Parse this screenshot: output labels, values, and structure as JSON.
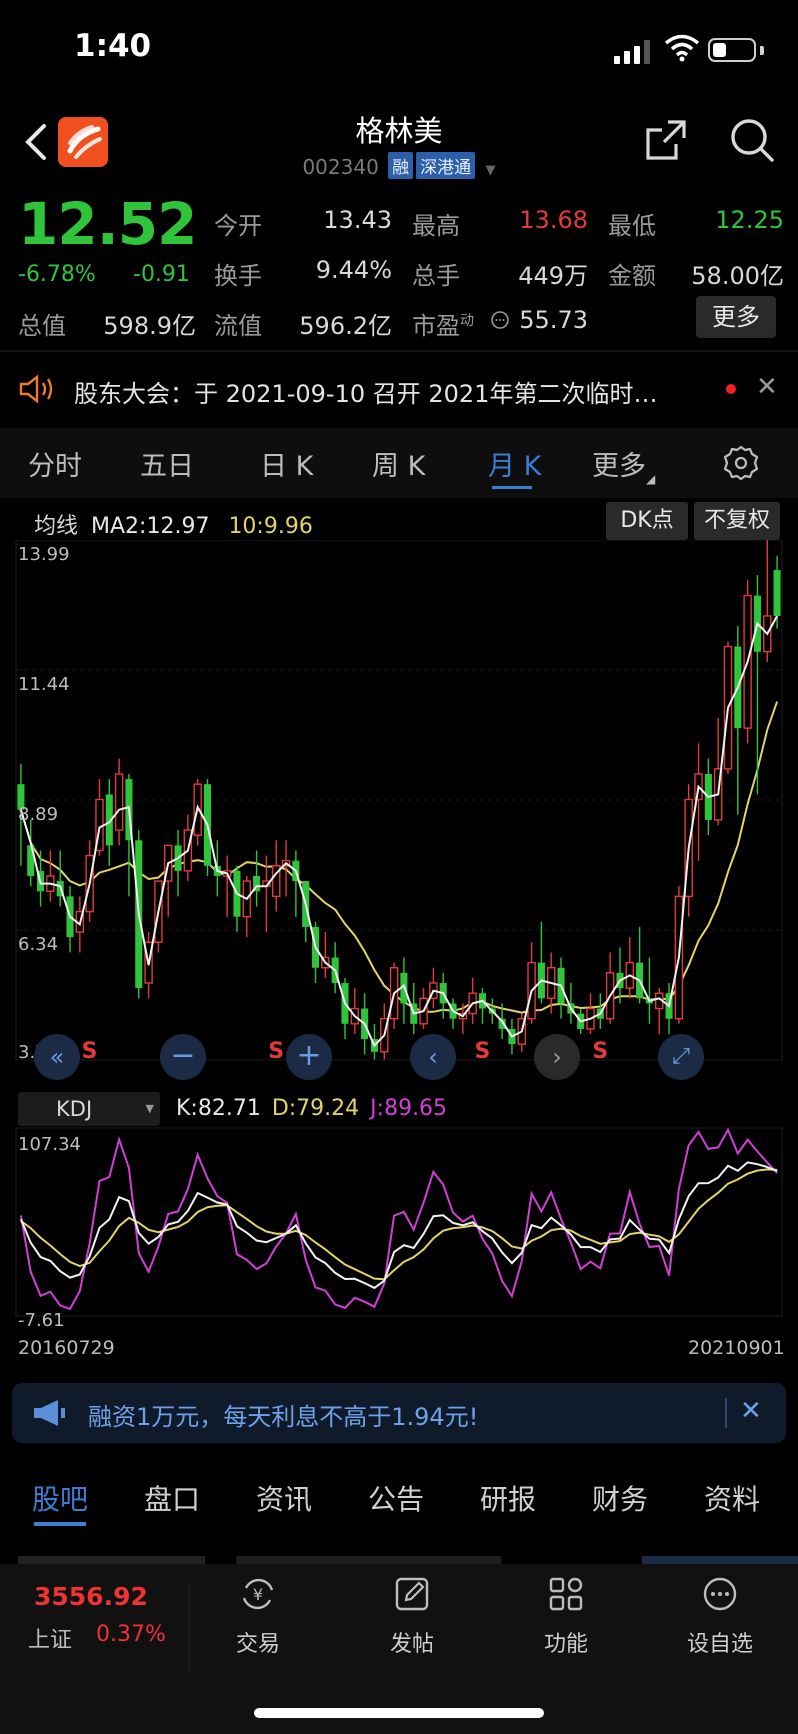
{
  "status_bar": {
    "time": "1:40"
  },
  "header": {
    "stock_name": "格林美",
    "stock_code": "002340",
    "tag_margin": "融",
    "tag_connect": "深港通",
    "icons": [
      "back-icon",
      "app-logo",
      "share-icon",
      "search-icon"
    ]
  },
  "quote": {
    "price": "12.52",
    "change_pct": "-6.78%",
    "change_amt": "-0.91",
    "open_label": "今开",
    "open": "13.43",
    "high_label": "最高",
    "high": "13.68",
    "low_label": "最低",
    "low": "12.25",
    "turnover_label": "换手",
    "turnover": "9.44%",
    "volume_label": "总手",
    "volume": "449万",
    "amount_label": "金额",
    "amount": "58.00亿",
    "mktcap_label": "总值",
    "mktcap": "598.9亿",
    "float_label": "流值",
    "float": "596.2亿",
    "pe_label": "市盈",
    "pe_sup": "动",
    "pe": "55.73",
    "more_label": "更多"
  },
  "colors": {
    "up": "#e33b3b",
    "down": "#2fc43a",
    "accent": "#3b7fd4",
    "ma_yellow": "#e3d46a",
    "kdj_j": "#d23fd6"
  },
  "notice": {
    "text": "股东大会：于 2021-09-10 召开 2021年第二次临时…"
  },
  "chart_tabs": [
    "分时",
    "五日",
    "日 K",
    "周 K",
    "月 K",
    "更多"
  ],
  "chart_tab_active": "月 K",
  "chart": {
    "ma_label": "均线",
    "ma2_text": "MA2:12.97",
    "ma10_text": "10:9.96",
    "dk_button": "DK点",
    "adjust_button": "不复权",
    "y_ticks": [
      "13.99",
      "11.44",
      "8.89",
      "6.34",
      "3.79"
    ],
    "signal_marker": "S"
  },
  "chart_data": [
    {
      "type": "candlestick",
      "title": "月 K",
      "ylim": [
        3.79,
        13.99
      ],
      "y_ticks": [
        13.99,
        11.44,
        8.89,
        6.34,
        3.79
      ],
      "x_range": [
        "20160729",
        "20210901"
      ],
      "candles": [
        [
          9.2,
          8.7,
          9.6,
          7.6
        ],
        [
          8.0,
          7.4,
          8.5,
          7.2
        ],
        [
          7.5,
          7.1,
          7.9,
          6.8
        ],
        [
          7.1,
          7.4,
          7.9,
          6.9
        ],
        [
          7.3,
          7.0,
          7.9,
          6.8
        ],
        [
          7.0,
          6.2,
          7.2,
          5.9
        ],
        [
          6.3,
          6.7,
          7.0,
          5.9
        ],
        [
          6.7,
          7.8,
          8.1,
          6.5
        ],
        [
          7.9,
          8.9,
          9.3,
          7.8
        ],
        [
          9.0,
          8.0,
          9.3,
          7.6
        ],
        [
          8.3,
          9.4,
          9.7,
          8.0
        ],
        [
          9.3,
          8.1,
          9.4,
          7.0
        ],
        [
          8.1,
          5.2,
          8.3,
          5.0
        ],
        [
          5.3,
          6.1,
          6.3,
          5.0
        ],
        [
          6.1,
          7.3,
          7.3,
          5.9
        ],
        [
          7.3,
          8.0,
          8.0,
          6.6
        ],
        [
          8.0,
          7.5,
          8.3,
          7.0
        ],
        [
          7.5,
          8.3,
          8.6,
          7.3
        ],
        [
          8.2,
          9.2,
          9.3,
          8.0
        ],
        [
          9.2,
          7.6,
          9.3,
          7.4
        ],
        [
          7.6,
          7.4,
          8.1,
          7.0
        ],
        [
          7.4,
          7.5,
          7.8,
          6.6
        ],
        [
          7.5,
          6.6,
          7.6,
          6.3
        ],
        [
          6.6,
          7.3,
          7.4,
          6.2
        ],
        [
          7.4,
          7.1,
          7.9,
          6.8
        ],
        [
          7.2,
          7.3,
          7.8,
          6.3
        ],
        [
          7.0,
          7.6,
          8.1,
          6.7
        ],
        [
          7.6,
          7.7,
          8.1,
          7.0
        ],
        [
          7.7,
          7.3,
          7.9,
          6.6
        ],
        [
          7.3,
          6.4,
          7.3,
          6.1
        ],
        [
          6.4,
          5.6,
          6.5,
          5.3
        ],
        [
          5.6,
          5.8,
          6.3,
          5.4
        ],
        [
          5.8,
          5.3,
          6.1,
          5.1
        ],
        [
          5.3,
          4.5,
          5.4,
          4.2
        ],
        [
          4.5,
          4.8,
          5.2,
          4.3
        ],
        [
          4.8,
          4.2,
          5.1,
          3.9
        ],
        [
          4.2,
          3.95,
          4.5,
          3.8
        ],
        [
          3.95,
          4.6,
          4.9,
          3.8
        ],
        [
          4.6,
          5.6,
          5.7,
          4.4
        ],
        [
          5.5,
          4.9,
          5.8,
          4.5
        ],
        [
          4.9,
          4.5,
          5.3,
          4.3
        ],
        [
          4.5,
          5.0,
          5.2,
          4.4
        ],
        [
          5.0,
          5.3,
          5.6,
          4.8
        ],
        [
          5.3,
          4.9,
          5.5,
          4.6
        ],
        [
          4.9,
          4.6,
          5.0,
          4.4
        ],
        [
          4.6,
          4.7,
          4.9,
          4.3
        ],
        [
          4.7,
          5.1,
          5.4,
          4.5
        ],
        [
          5.1,
          4.8,
          5.2,
          4.5
        ],
        [
          4.8,
          4.7,
          5.0,
          4.5
        ],
        [
          4.6,
          4.4,
          4.9,
          4.2
        ],
        [
          4.4,
          4.1,
          4.6,
          3.9
        ],
        [
          4.1,
          4.6,
          4.7,
          3.95
        ],
        [
          4.6,
          5.7,
          6.1,
          4.5
        ],
        [
          5.7,
          5.0,
          6.5,
          4.9
        ],
        [
          5.0,
          5.6,
          5.9,
          4.7
        ],
        [
          5.6,
          4.9,
          5.8,
          4.6
        ],
        [
          4.9,
          4.7,
          5.3,
          4.5
        ],
        [
          4.7,
          4.4,
          4.8,
          4.3
        ],
        [
          4.4,
          4.8,
          5.1,
          4.3
        ],
        [
          4.8,
          4.6,
          5.1,
          4.4
        ],
        [
          4.6,
          5.5,
          5.9,
          4.5
        ],
        [
          5.5,
          5.2,
          6.0,
          4.9
        ],
        [
          5.2,
          5.7,
          6.2,
          5.0
        ],
        [
          5.7,
          5.0,
          6.4,
          4.9
        ],
        [
          5.0,
          4.9,
          5.8,
          4.5
        ],
        [
          4.8,
          5.1,
          5.2,
          4.3
        ],
        [
          5.1,
          4.6,
          5.3,
          4.3
        ],
        [
          4.6,
          7.0,
          7.2,
          4.5
        ],
        [
          7.0,
          8.9,
          9.2,
          6.6
        ],
        [
          8.9,
          9.4,
          10.0,
          7.7
        ],
        [
          9.4,
          8.5,
          9.7,
          8.2
        ],
        [
          8.5,
          9.5,
          10.5,
          8.4
        ],
        [
          9.5,
          11.9,
          12.0,
          9.4
        ],
        [
          11.9,
          10.3,
          12.3,
          8.6
        ],
        [
          10.3,
          12.9,
          13.2,
          10.0
        ],
        [
          12.9,
          11.8,
          13.3,
          9.0
        ],
        [
          11.8,
          12.5,
          13.99,
          11.6
        ],
        [
          13.4,
          12.5,
          13.68,
          12.25
        ]
      ],
      "ma_lines": [
        "MA2",
        "MA10"
      ],
      "signals": [
        "S",
        "S",
        "S",
        "S",
        "S"
      ]
    },
    {
      "type": "line",
      "title": "KDJ",
      "ylim": [
        -7.61,
        107.34
      ],
      "series": [
        {
          "name": "K",
          "last": 82.71
        },
        {
          "name": "D",
          "last": 79.24
        },
        {
          "name": "J",
          "last": 89.65
        }
      ]
    }
  ],
  "kdj": {
    "selector": "KDJ",
    "k_text": "K:82.71",
    "d_text": "D:79.24",
    "j_text": "J:89.65",
    "ymax": "107.34",
    "ymin": "-7.61",
    "date_start": "20160729",
    "date_end": "20210901"
  },
  "promo": {
    "text": "融资1万元，每天利息不高于1.94元!"
  },
  "bottom_tabs": [
    "股吧",
    "盘口",
    "资讯",
    "公告",
    "研报",
    "财务",
    "资料"
  ],
  "bottom_tab_active": "股吧",
  "dock": {
    "index_value": "3556.92",
    "index_name": "上证",
    "index_pct": "0.37%",
    "items": [
      "交易",
      "发帖",
      "功能",
      "设自选"
    ]
  }
}
